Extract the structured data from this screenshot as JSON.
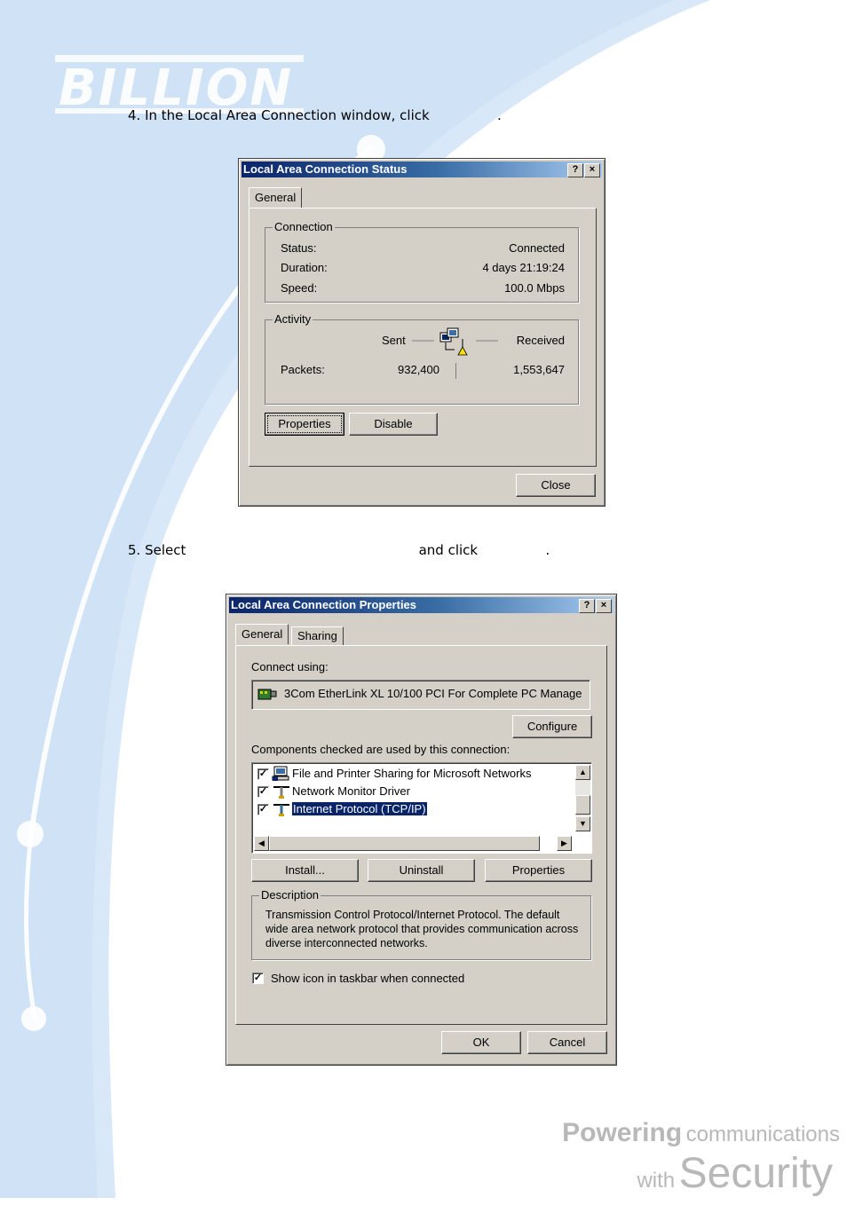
{
  "brand": {
    "logo_text": "BILLION"
  },
  "steps": [
    {
      "text": "4. In the Local Area Connection window, click                ."
    },
    {
      "text": "5. Select                                                       and click                ."
    }
  ],
  "status_dialog": {
    "title": "Local Area Connection Status",
    "help_button": "?",
    "close_x": "×",
    "tab_general": "General",
    "connection_group": "Connection",
    "status_label": "Status:",
    "status_value": "Connected",
    "duration_label": "Duration:",
    "duration_value": "4 days 21:19:24",
    "speed_label": "Speed:",
    "speed_value": "100.0 Mbps",
    "activity_group": "Activity",
    "sent_label": "Sent",
    "received_label": "Received",
    "packets_label": "Packets:",
    "packets_sent": "932,400",
    "packets_received": "1,553,647",
    "properties_button": "Properties",
    "disable_button": "Disable",
    "close_button": "Close"
  },
  "properties_dialog": {
    "title": "Local Area Connection Properties",
    "help_button": "?",
    "close_x": "×",
    "tab_general": "General",
    "tab_sharing": "Sharing",
    "connect_using_label": "Connect using:",
    "adapter_name": "3Com EtherLink XL 10/100 PCI For Complete PC Manage",
    "configure_button": "Configure",
    "components_label": "Components checked are used by this connection:",
    "components": [
      {
        "label": "File and Printer Sharing for Microsoft Networks",
        "checked": true,
        "icon": "network-share-icon"
      },
      {
        "label": "Network Monitor Driver",
        "checked": true,
        "icon": "protocol-icon"
      },
      {
        "label": "Internet Protocol (TCP/IP)",
        "checked": true,
        "icon": "protocol-icon",
        "selected": true
      }
    ],
    "install_button": "Install...",
    "uninstall_button": "Uninstall",
    "properties_button": "Properties",
    "description_group": "Description",
    "description_text": "Transmission Control Protocol/Internet Protocol. The default wide area network protocol that provides communication across diverse interconnected networks.",
    "show_icon_label": "Show icon in taskbar when connected",
    "show_icon_checked": true,
    "ok_button": "OK",
    "cancel_button": "Cancel"
  },
  "footer": {
    "line1_bold": "Powering",
    "line1_rest": "communications",
    "line2_small": "with",
    "line2_big": "Security"
  },
  "colors": {
    "title_start": "#0a246a",
    "title_end": "#a6caf0",
    "dialog_face": "#d4d0c8",
    "bg_blue": "#d9e9f9"
  }
}
